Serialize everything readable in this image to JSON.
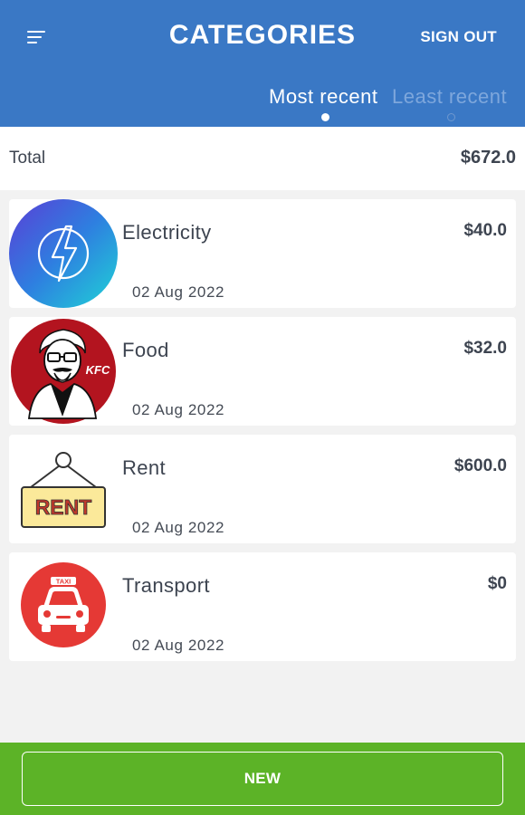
{
  "header": {
    "title": "CATEGORIES",
    "sign_out_label": "SIGN OUT",
    "menu_icon": "menu-icon"
  },
  "tabs": [
    {
      "label": "Most recent",
      "active": true
    },
    {
      "label": "Least recent",
      "active": false
    }
  ],
  "total": {
    "label": "Total",
    "value": "$672.0"
  },
  "categories": [
    {
      "name": "Electricity",
      "amount": "$40.0",
      "date": "02 Aug 2022",
      "icon": "lightning-icon"
    },
    {
      "name": "Food",
      "amount": "$32.0",
      "date": "02 Aug 2022",
      "icon": "kfc-logo-icon"
    },
    {
      "name": "Rent",
      "amount": "$600.0",
      "date": "02 Aug 2022",
      "icon": "rent-sign-icon"
    },
    {
      "name": "Transport",
      "amount": "$0",
      "date": "02 Aug 2022",
      "icon": "taxi-icon"
    }
  ],
  "rent_sign_text": "RENT",
  "taxi_sign_text": "TAXI",
  "kfc_logo_text": "KFC",
  "footer": {
    "new_label": "NEW"
  },
  "colors": {
    "header": "#3a78c5",
    "footer": "#5cb327",
    "tab_inactive": "#7ea7dc",
    "text": "#3d4450"
  }
}
